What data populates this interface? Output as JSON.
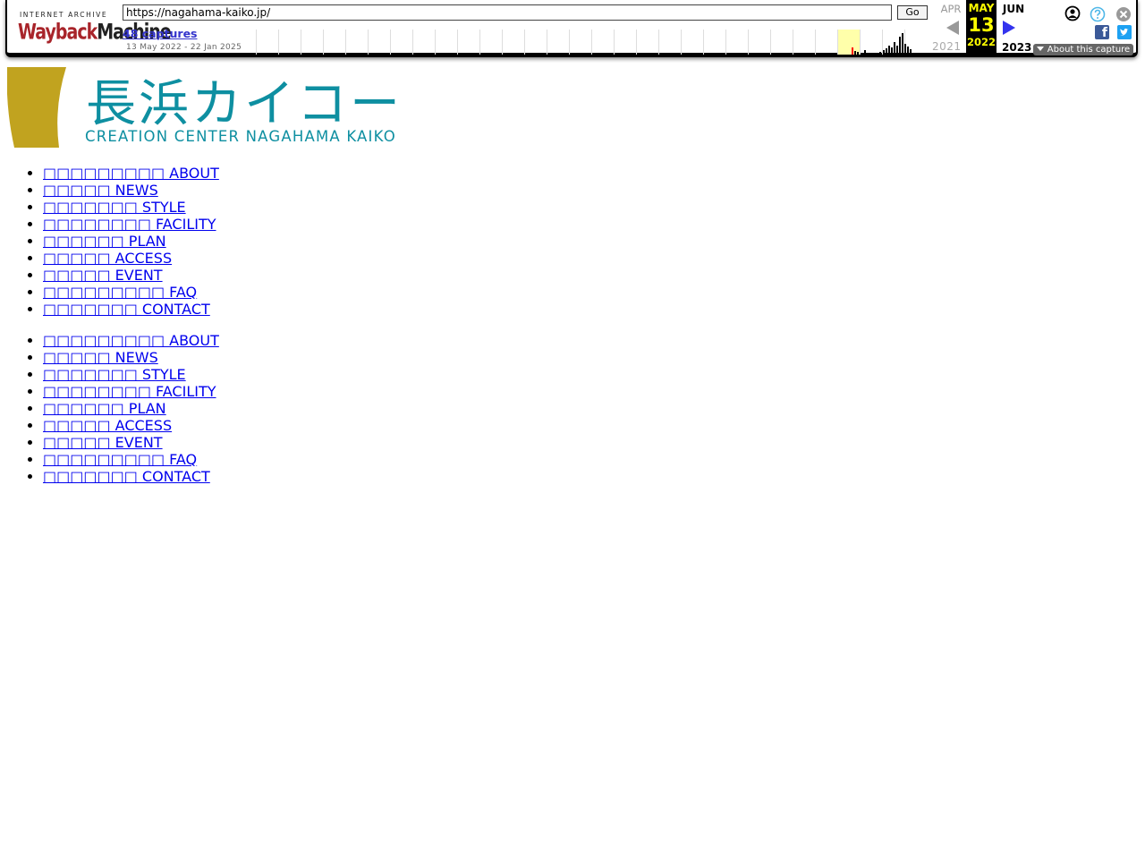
{
  "wayback": {
    "logo_top": "INTERNET ARCHIVE",
    "logo_wayback": "Wayback",
    "logo_machine": "Machine",
    "url": "https://nagahama-kaiko.jp/",
    "go_label": "Go",
    "captures_label": "48 captures",
    "date_range": "13 May 2022 - 22 Jan 2025",
    "prev_month": "APR",
    "current_month": "MAY",
    "current_day": "13",
    "current_year": "2022",
    "next_month": "JUN",
    "prev_year": "2021",
    "next_year": "2023",
    "about_capture": "About this capture",
    "facebook_glyph": "f",
    "icons": {
      "user": "user-circle-icon",
      "help": "question-icon",
      "close": "close-icon",
      "facebook": "facebook-icon",
      "twitter": "twitter-icon",
      "prev": "arrow-left-icon",
      "next": "arrow-right-icon"
    }
  },
  "site": {
    "logo_jp": "長浜カイコー",
    "logo_en": "CREATION CENTER NAGAHAMA KAIKO",
    "colors": {
      "logo_teal": "#0e8fa1",
      "logo_gold": "#c1a31f"
    }
  },
  "nav_primary": [
    {
      "label": "□□□□□□□□□ ABOUT"
    },
    {
      "label": "□□□□□ NEWS"
    },
    {
      "label": "□□□□□□□ STYLE"
    },
    {
      "label": "□□□□□□□□ FACILITY"
    },
    {
      "label": "□□□□□□ PLAN"
    },
    {
      "label": "□□□□□ ACCESS"
    },
    {
      "label": "□□□□□ EVENT"
    },
    {
      "label": "□□□□□□□□□ FAQ"
    },
    {
      "label": "□□□□□□□ CONTACT"
    }
  ],
  "nav_secondary": [
    {
      "label": "□□□□□□□□□ ABOUT"
    },
    {
      "label": "□□□□□ NEWS"
    },
    {
      "label": "□□□□□□□ STYLE"
    },
    {
      "label": "□□□□□□□□ FACILITY"
    },
    {
      "label": "□□□□□□ PLAN"
    },
    {
      "label": "□□□□□ ACCESS"
    },
    {
      "label": "□□□□□ EVENT"
    },
    {
      "label": "□□□□□□□□□ FAQ"
    },
    {
      "label": "□□□□□□□ CONTACT"
    }
  ]
}
